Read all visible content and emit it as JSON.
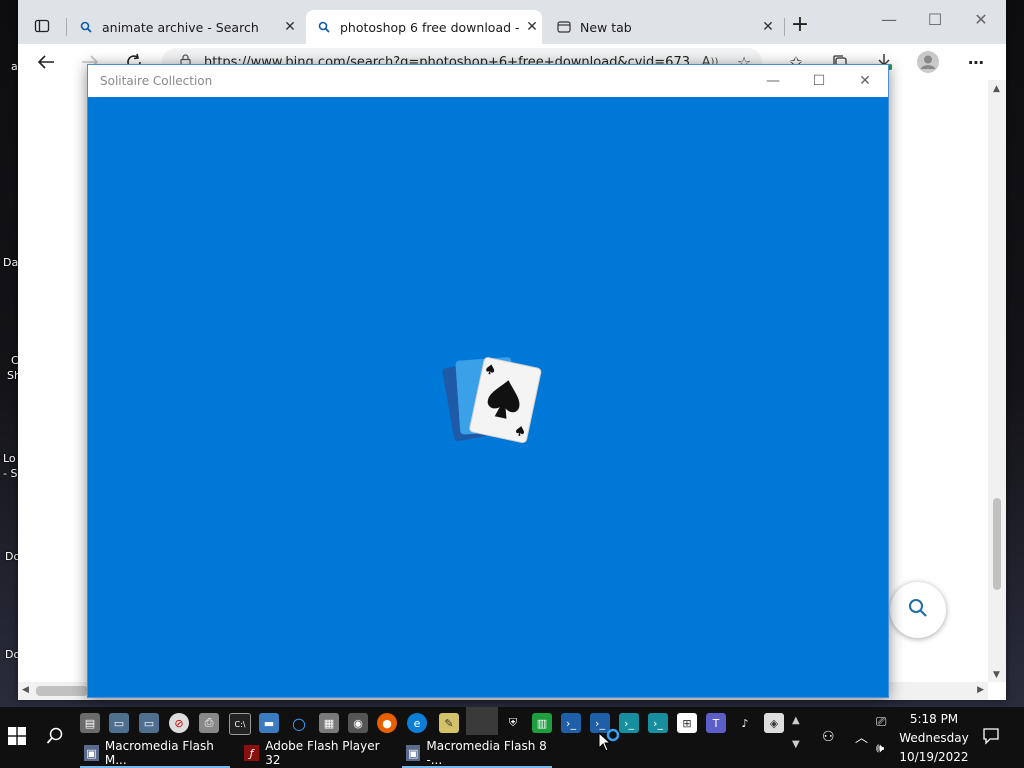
{
  "desktop": {
    "labels": [
      "a",
      "Da",
      "C",
      "Sh",
      "Lo",
      "- S",
      "Do",
      "Do"
    ]
  },
  "browser": {
    "tabs": [
      {
        "label": "animate archive - Search",
        "icon": "search-icon"
      },
      {
        "label": "photoshop 6 free download - Se",
        "icon": "search-icon",
        "active": true
      },
      {
        "label": "New tab",
        "icon": "new-tab-icon"
      }
    ],
    "new_tab": "+",
    "url": "https://www.bing.com/search?q=photoshop+6+free+download&cvid=673"
  },
  "solitaire": {
    "title": "Solitaire Collection",
    "bg_color": "#0078d7"
  },
  "taskbar": {
    "tasks": [
      {
        "label": "Macromedia Flash M...",
        "icon": "flash-mx-icon"
      },
      {
        "label": "Adobe Flash Player 32",
        "icon": "flash-player-icon"
      },
      {
        "label": "Macromedia Flash 8 -...",
        "icon": "flash-8-icon"
      }
    ],
    "time": "5:18 PM",
    "day": "Wednesday",
    "date": "10/19/2022"
  }
}
